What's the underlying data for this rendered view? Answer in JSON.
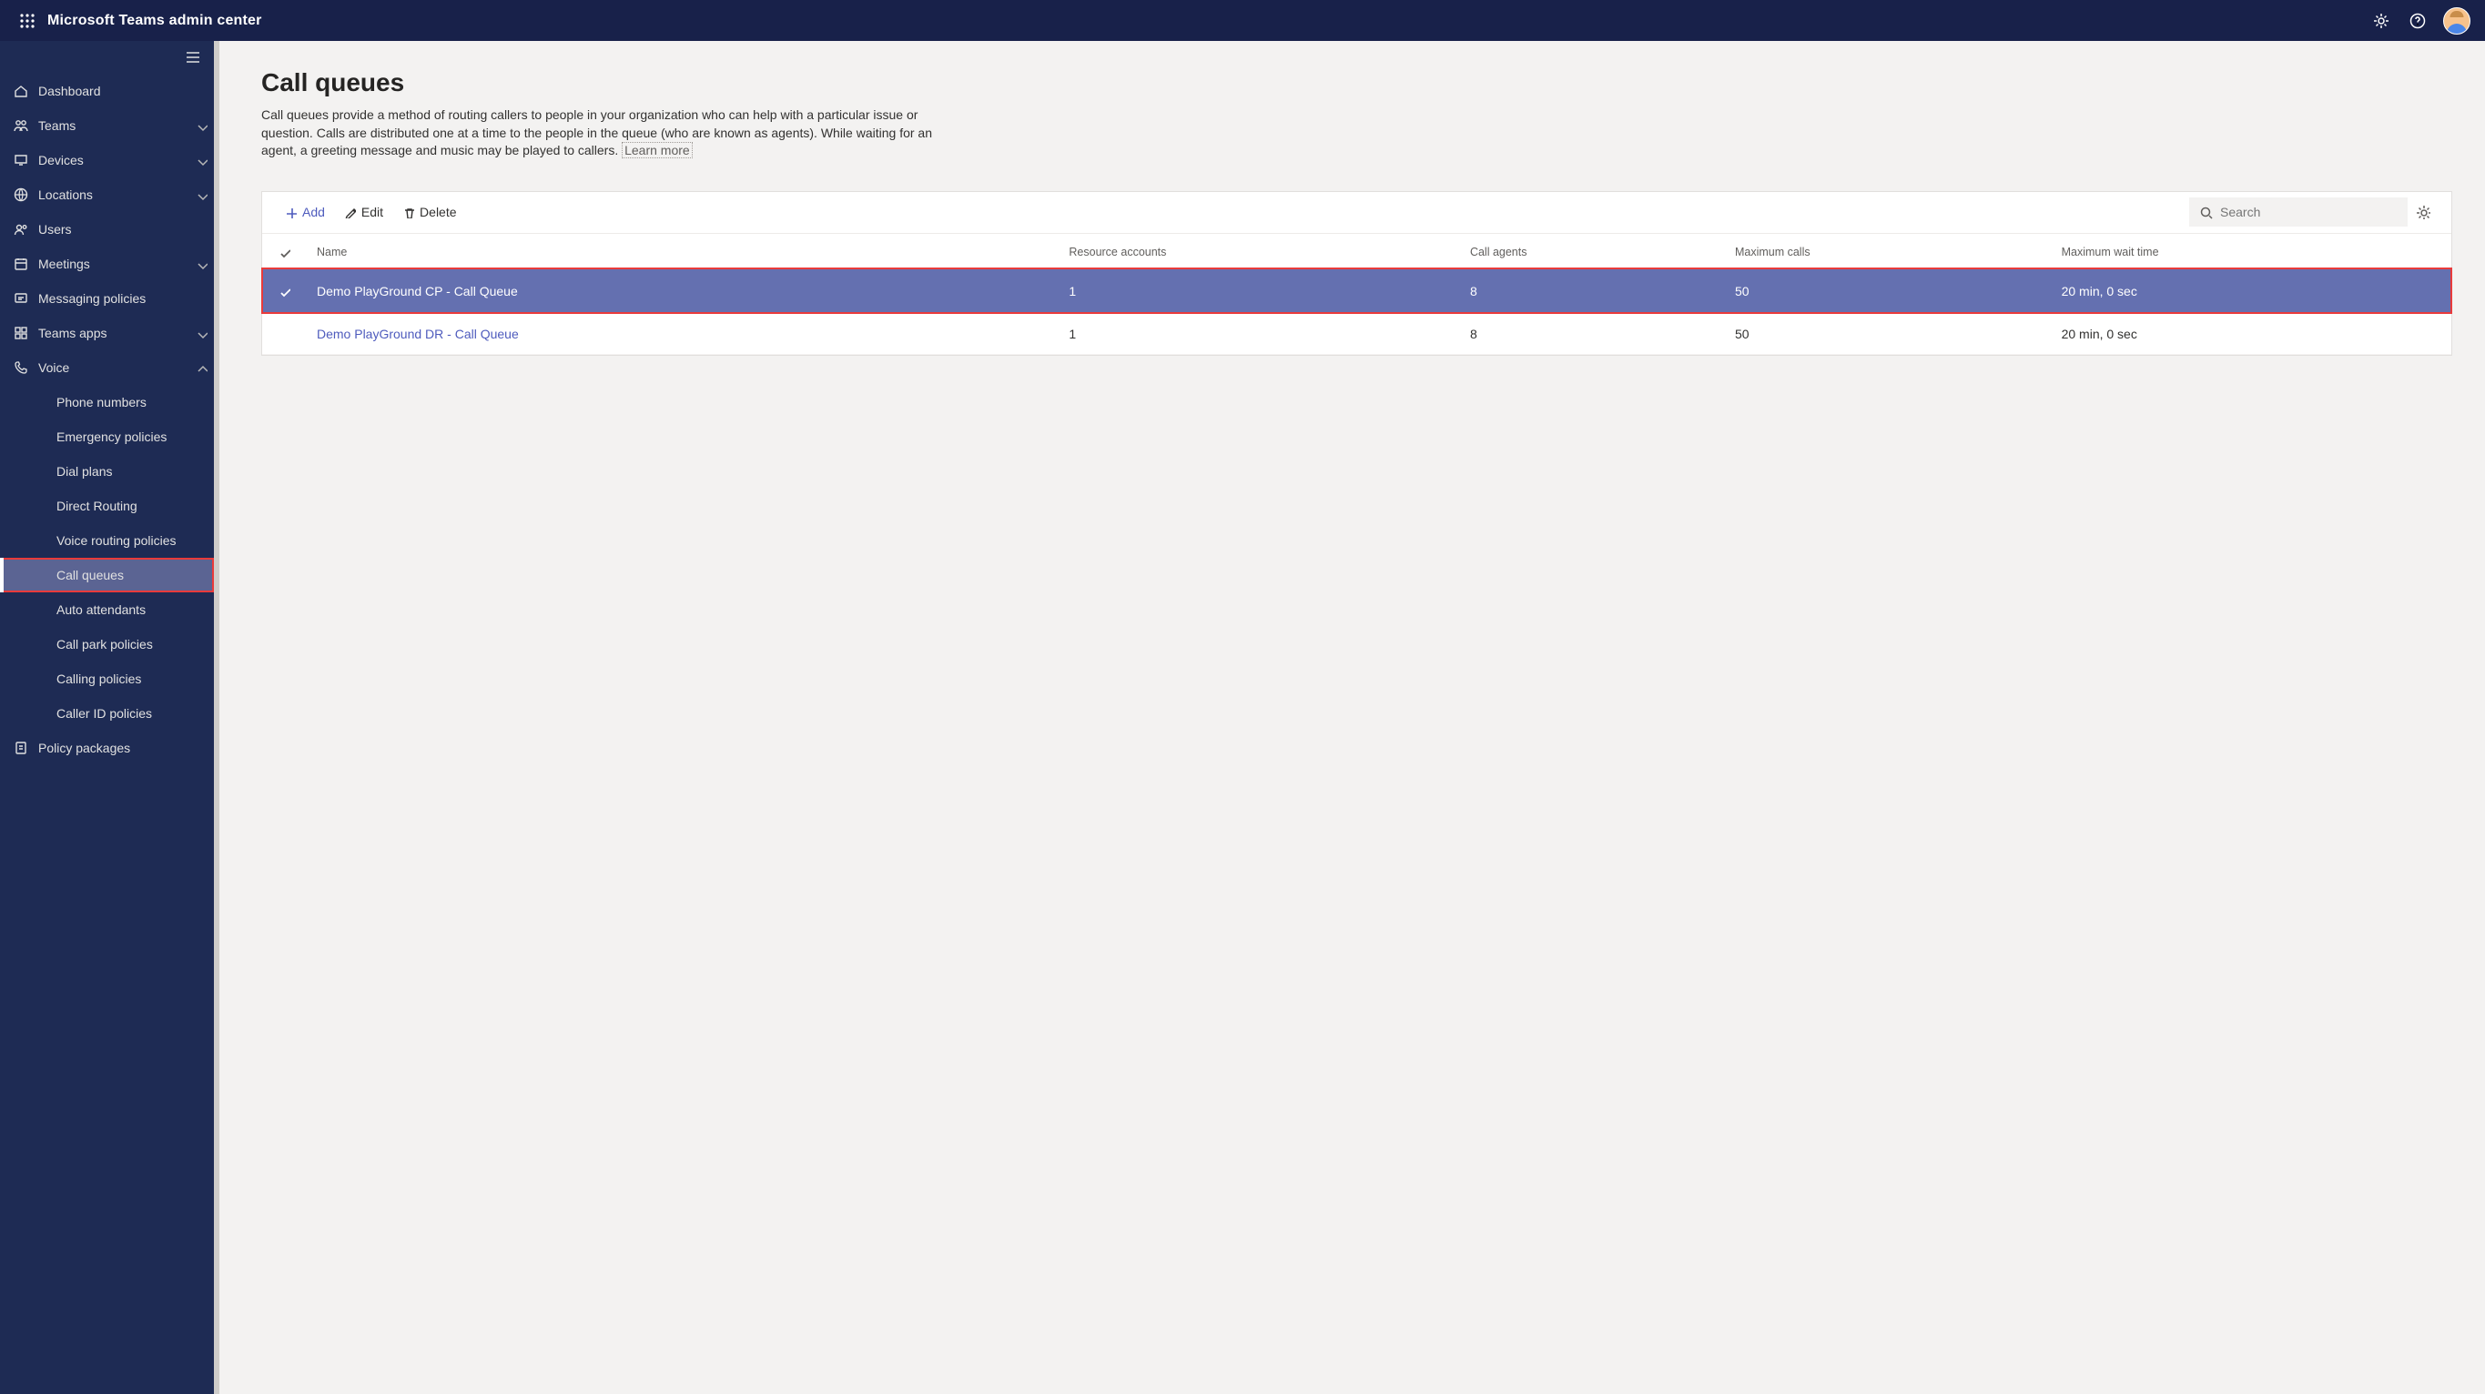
{
  "header": {
    "product_name": "Microsoft Teams admin center"
  },
  "sidebar": {
    "items": [
      {
        "icon": "home",
        "label": "Dashboard",
        "expandable": false
      },
      {
        "icon": "teams",
        "label": "Teams",
        "expandable": true
      },
      {
        "icon": "devices",
        "label": "Devices",
        "expandable": true
      },
      {
        "icon": "globe",
        "label": "Locations",
        "expandable": true
      },
      {
        "icon": "users",
        "label": "Users",
        "expandable": false
      },
      {
        "icon": "calendar",
        "label": "Meetings",
        "expandable": true
      },
      {
        "icon": "message",
        "label": "Messaging policies",
        "expandable": false
      },
      {
        "icon": "apps",
        "label": "Teams apps",
        "expandable": true
      },
      {
        "icon": "phone",
        "label": "Voice",
        "expandable": true,
        "expanded": true
      }
    ],
    "voice_subitems": [
      {
        "label": "Phone numbers"
      },
      {
        "label": "Emergency policies"
      },
      {
        "label": "Dial plans"
      },
      {
        "label": "Direct Routing"
      },
      {
        "label": "Voice routing policies"
      },
      {
        "label": "Call queues",
        "active": true,
        "highlighted": true
      },
      {
        "label": "Auto attendants"
      },
      {
        "label": "Call park policies"
      },
      {
        "label": "Calling policies"
      },
      {
        "label": "Caller ID policies"
      }
    ],
    "tail_item": {
      "icon": "policy",
      "label": "Policy packages"
    }
  },
  "page": {
    "title": "Call queues",
    "description": "Call queues provide a method of routing callers to people in your organization who can help with a particular issue or question. Calls are distributed one at a time to the people in the queue (who are known as agents). While waiting for an agent, a greeting message and music may be played to callers. ",
    "learn_more": "Learn more"
  },
  "toolbar": {
    "add": "Add",
    "edit": "Edit",
    "delete": "Delete",
    "search_placeholder": "Search"
  },
  "table": {
    "columns": {
      "name": "Name",
      "resource_accounts": "Resource accounts",
      "call_agents": "Call agents",
      "max_calls": "Maximum calls",
      "max_wait": "Maximum wait time"
    },
    "rows": [
      {
        "name": "Demo PlayGround CP - Call Queue",
        "resource_accounts": "1",
        "call_agents": "8",
        "max_calls": "50",
        "max_wait": "20 min, 0 sec",
        "selected": true,
        "highlighted": true
      },
      {
        "name": "Demo PlayGround DR - Call Queue",
        "resource_accounts": "1",
        "call_agents": "8",
        "max_calls": "50",
        "max_wait": "20 min, 0 sec",
        "selected": false,
        "highlighted": false
      }
    ]
  }
}
